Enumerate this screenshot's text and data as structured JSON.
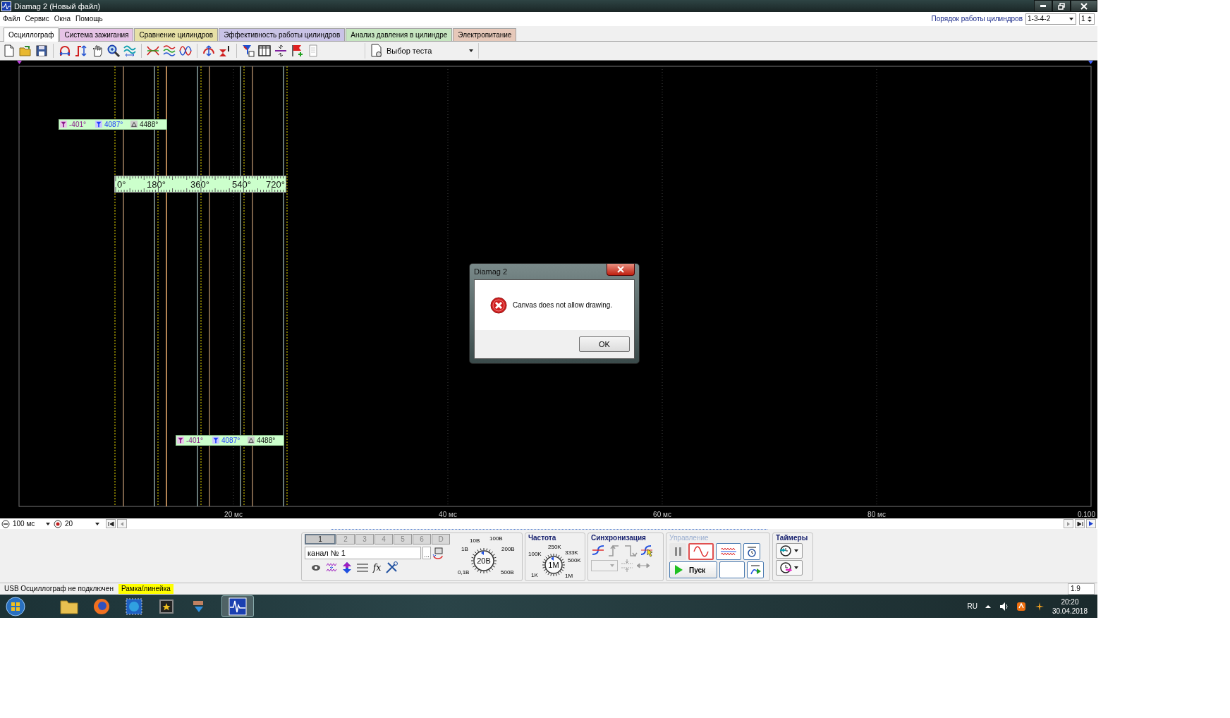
{
  "window": {
    "title": "Diamag 2 (Новый файл)"
  },
  "menu": [
    "Файл",
    "Сервис",
    "Окна",
    "Помощь"
  ],
  "cylinder_order": {
    "label": "Порядок работы цилиндров",
    "value": "1-3-4-2",
    "count": "1"
  },
  "tabs": [
    {
      "label": "Осциллограф",
      "selected": true,
      "color": "#ffffff"
    },
    {
      "label": "Система зажигания",
      "selected": false,
      "color": "#e6c3e6"
    },
    {
      "label": "Сравнение цилиндров",
      "selected": false,
      "color": "#e6e0a6"
    },
    {
      "label": "Эффективность работы цилиндров",
      "selected": false,
      "color": "#c9c3e6"
    },
    {
      "label": "Анализ давления в цилиндре",
      "selected": false,
      "color": "#c6e6c0"
    },
    {
      "label": "Электропитание",
      "selected": false,
      "color": "#e6c8b9"
    }
  ],
  "toolbar": {
    "test_select": "Выбор теста"
  },
  "scope": {
    "marker_labels": [
      {
        "start": "-401°",
        "end": "4087°",
        "delta": "4488°"
      },
      {
        "start": "-401°",
        "end": "4087°",
        "delta": "4488°"
      }
    ],
    "ruler": [
      "0°",
      "180°",
      "360°",
      "540°",
      "720°"
    ],
    "x_axis": [
      "20 мс",
      "40 мс",
      "60 мс",
      "80 мс",
      "0.100"
    ]
  },
  "scroll": {
    "time_scale": "100 мс",
    "zoom": "20"
  },
  "channel": {
    "buttons": [
      {
        "label": "1",
        "selected": true
      },
      {
        "label": "2",
        "selected": false
      },
      {
        "label": "3",
        "selected": false
      },
      {
        "label": "4",
        "selected": false
      },
      {
        "label": "5",
        "selected": false
      },
      {
        "label": "6",
        "selected": false
      },
      {
        "label": "D",
        "selected": false
      }
    ],
    "name": "канал № 1",
    "more": "...",
    "formula": "fx",
    "voltage": {
      "value": "20В",
      "scale": [
        "10В",
        "100В",
        "1В",
        "200В",
        "0,1В",
        "500В"
      ]
    }
  },
  "frequency": {
    "title": "Частота",
    "value": "1M",
    "scale": [
      "100K",
      "250K",
      "333K",
      "500K",
      "1K",
      "1M"
    ]
  },
  "sync": {
    "title": "Синхронизация"
  },
  "control": {
    "title": "Управление",
    "disabled": true,
    "start": "Пуск",
    "modes": [
      {
        "kind": "pause",
        "selected": false,
        "disabled": true
      },
      {
        "kind": "sine",
        "selected": true,
        "disabled": false
      },
      {
        "kind": "noise",
        "selected": false,
        "disabled": false
      }
    ]
  },
  "timers": {
    "title": "Таймеры"
  },
  "status_bar": [
    {
      "text": "USB Осциллограф не подключен",
      "highlighted": false
    },
    {
      "text": "Рамка/линейка",
      "highlighted": true
    },
    {
      "text": "1.9",
      "highlighted": false
    }
  ],
  "taskbar": {
    "language": "RU",
    "time": "20:20",
    "date": "30.04.2018"
  },
  "dialog": {
    "title": "Diamag 2",
    "message": "Canvas does not allow drawing.",
    "button": "OK"
  }
}
